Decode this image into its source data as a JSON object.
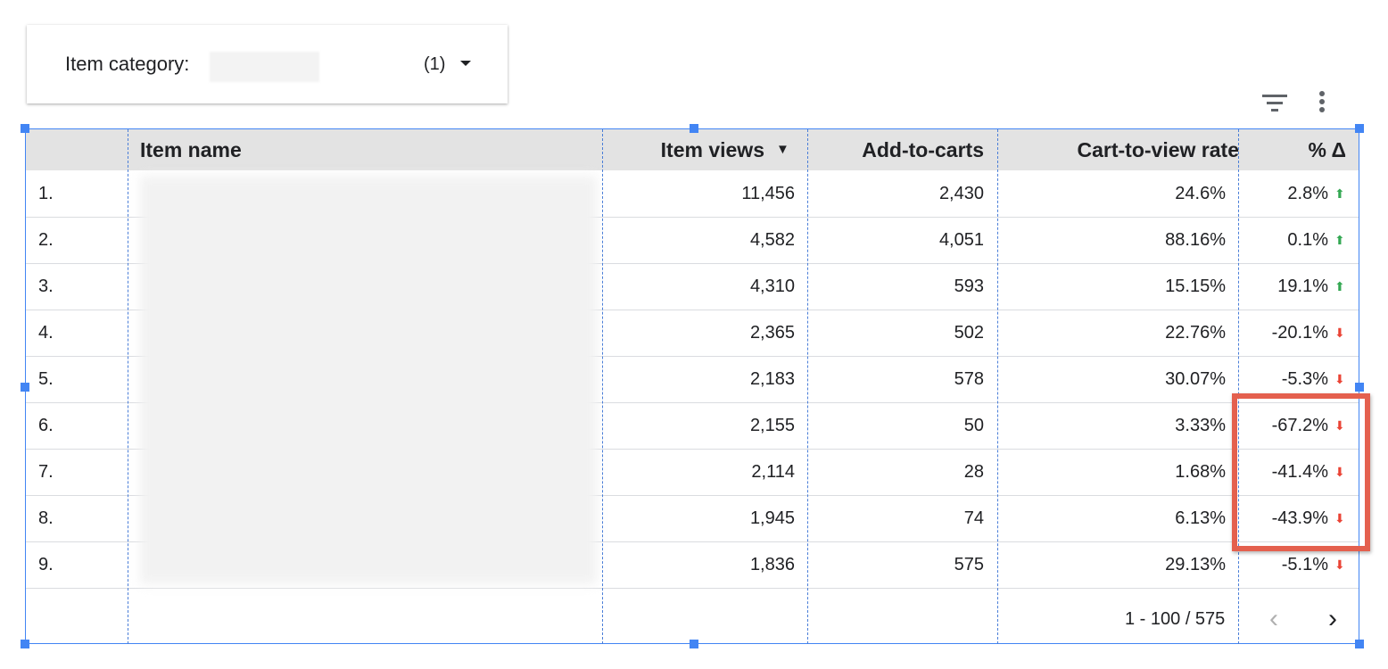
{
  "filter": {
    "label": "Item category:",
    "count": "(1)"
  },
  "toolbar": {
    "filter_icon": "filter-list-icon",
    "more_icon": "more-vert-icon"
  },
  "table": {
    "headers": {
      "index": "",
      "name": "Item name",
      "views": "Item views",
      "sort_icon": "▼",
      "adds": "Add-to-carts",
      "rate": "Cart-to-view rate",
      "delta": "% Δ"
    },
    "rows": [
      {
        "index": "1.",
        "views": "11,456",
        "adds": "2,430",
        "rate": "24.6%",
        "delta": "2.8%",
        "dir": "up"
      },
      {
        "index": "2.",
        "views": "4,582",
        "adds": "4,051",
        "rate": "88.16%",
        "delta": "0.1%",
        "dir": "up"
      },
      {
        "index": "3.",
        "views": "4,310",
        "adds": "593",
        "rate": "15.15%",
        "delta": "19.1%",
        "dir": "up"
      },
      {
        "index": "4.",
        "views": "2,365",
        "adds": "502",
        "rate": "22.76%",
        "delta": "-20.1%",
        "dir": "down"
      },
      {
        "index": "5.",
        "views": "2,183",
        "adds": "578",
        "rate": "30.07%",
        "delta": "-5.3%",
        "dir": "down"
      },
      {
        "index": "6.",
        "views": "2,155",
        "adds": "50",
        "rate": "3.33%",
        "delta": "-67.2%",
        "dir": "down"
      },
      {
        "index": "7.",
        "views": "2,114",
        "adds": "28",
        "rate": "1.68%",
        "delta": "-41.4%",
        "dir": "down"
      },
      {
        "index": "8.",
        "views": "1,945",
        "adds": "74",
        "rate": "6.13%",
        "delta": "-43.9%",
        "dir": "down"
      },
      {
        "index": "9.",
        "views": "1,836",
        "adds": "575",
        "rate": "29.13%",
        "delta": "-5.1%",
        "dir": "down"
      }
    ],
    "pagination": {
      "range": "1 - 100 / 575",
      "prev": "‹",
      "next": "›"
    }
  },
  "colors": {
    "up": "#34a853",
    "down": "#ea4335",
    "highlight": "#e4604e",
    "selection": "#4285f4"
  }
}
